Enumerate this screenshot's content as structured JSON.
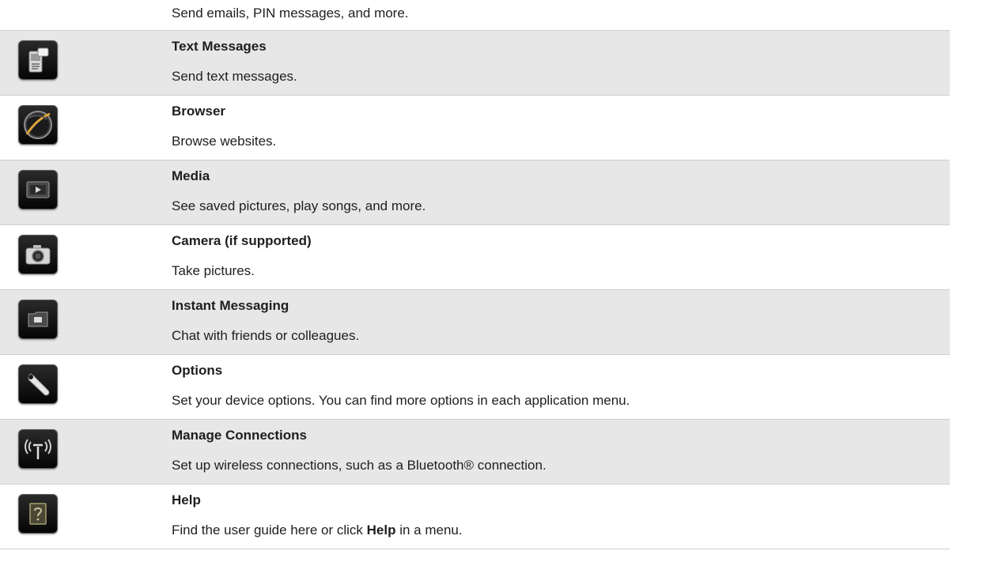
{
  "intro": {
    "desc": "Send emails, PIN messages, and more."
  },
  "items": [
    {
      "title": "Text Messages",
      "desc": "Send text messages.",
      "icon": "text-messages-icon"
    },
    {
      "title": "Browser",
      "desc": "Browse websites.",
      "icon": "browser-globe-icon"
    },
    {
      "title": "Media",
      "desc": "See saved pictures, play songs, and more.",
      "icon": "media-play-icon"
    },
    {
      "title": "Camera (if supported)",
      "desc": "Take pictures.",
      "icon": "camera-icon"
    },
    {
      "title": "Instant Messaging",
      "desc": "Chat with friends or colleagues.",
      "icon": "instant-messaging-icon"
    },
    {
      "title": "Options",
      "desc": "Set your device options. You can find more options in each application menu.",
      "icon": "wrench-icon"
    },
    {
      "title": "Manage Connections",
      "desc": "Set up wireless connections, such as a Bluetooth® connection.",
      "icon": "antenna-icon"
    },
    {
      "title": "Help",
      "desc_prefix": "Find the user guide here or click ",
      "desc_bold": "Help",
      "desc_suffix": " in a menu.",
      "icon": "help-question-icon"
    }
  ]
}
